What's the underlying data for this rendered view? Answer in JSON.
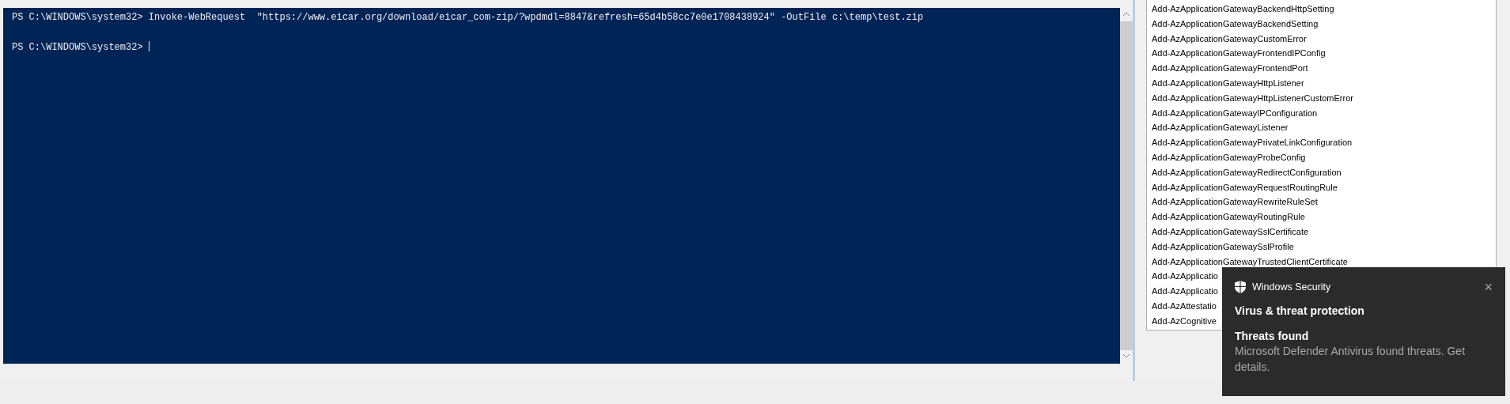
{
  "console": {
    "lines": [
      "PS C:\\WINDOWS\\system32> Invoke-WebRequest  \"https://www.eicar.org/download/eicar_com-zip/?wpdmdl=8847&refresh=65d4b58cc7e0e1708438924\" -OutFile c:\\temp\\test.zip",
      "PS C:\\WINDOWS\\system32> "
    ],
    "cursor": true
  },
  "commands": {
    "items": [
      "Add-AzApplicationGatewayBackendHttpSetting",
      "Add-AzApplicationGatewayBackendSetting",
      "Add-AzApplicationGatewayCustomError",
      "Add-AzApplicationGatewayFrontendIPConfig",
      "Add-AzApplicationGatewayFrontendPort",
      "Add-AzApplicationGatewayHttpListener",
      "Add-AzApplicationGatewayHttpListenerCustomError",
      "Add-AzApplicationGatewayIPConfiguration",
      "Add-AzApplicationGatewayListener",
      "Add-AzApplicationGatewayPrivateLinkConfiguration",
      "Add-AzApplicationGatewayProbeConfig",
      "Add-AzApplicationGatewayRedirectConfiguration",
      "Add-AzApplicationGatewayRequestRoutingRule",
      "Add-AzApplicationGatewayRewriteRuleSet",
      "Add-AzApplicationGatewayRoutingRule",
      "Add-AzApplicationGatewaySslCertificate",
      "Add-AzApplicationGatewaySslProfile",
      "Add-AzApplicationGatewayTrustedClientCertificate",
      "Add-AzApplicatio",
      "Add-AzApplicatio",
      "Add-AzAttestatio",
      "Add-AzCognitive"
    ]
  },
  "notification": {
    "app": "Windows Security",
    "close": "×",
    "title": "Virus & threat protection",
    "heading": "Threats found",
    "message": "Microsoft Defender Antivirus found threats. Get details."
  }
}
